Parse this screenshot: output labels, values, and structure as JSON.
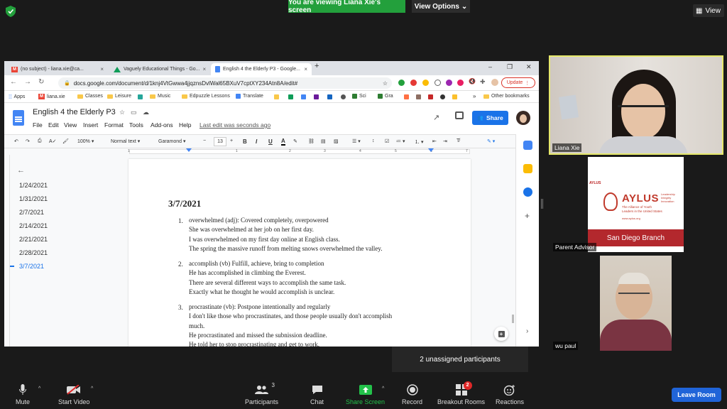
{
  "zoom": {
    "viewing_text": "You are viewing Liana Xie's screen",
    "view_options": "View Options",
    "view_label": "View",
    "unassigned": "2 unassigned participants",
    "participants_count": "3",
    "breakout_badge": "2",
    "controls": {
      "mute": "Mute",
      "start_video": "Start Video",
      "participants": "Participants",
      "chat": "Chat",
      "share_screen": "Share Screen",
      "record": "Record",
      "breakout_rooms": "Breakout Rooms",
      "reactions": "Reactions",
      "leave": "Leave Room"
    },
    "tiles": [
      {
        "name": "Liana Xie"
      },
      {
        "name": "Parent Advisor"
      },
      {
        "name": "wu paul"
      }
    ],
    "aylus": {
      "tag": "AYLUS",
      "word": "AYLUS",
      "subtitle": "The Alliance of Youth Leaders in the United States",
      "side": "Leadership Integrity Innovation",
      "url": "www.aylus.org",
      "branch": "San Diego Branch"
    },
    "colors": {
      "green": "#23a03c",
      "leave": "#2064d8",
      "highlight": "#e6e86b"
    }
  },
  "browser": {
    "tabs": [
      {
        "label": "(no subject) - liana.xie@ca..."
      },
      {
        "label": "Vaguely Educational Things - Go..."
      },
      {
        "label": "English 4 the Elderly P3 - Google..."
      }
    ],
    "url": "docs.google.com/document/d/1knj4VtGwwa4jjqznsDvlWal65BXuV7cptXY234Atn8A/edit#",
    "update_label": "Update",
    "bookmarks": [
      "Apps",
      "liana.xie",
      "Classes",
      "Leisure",
      "Music",
      "Edpuzzle Lessons",
      "Translate",
      "Sci",
      "Gra",
      "Other bookmarks"
    ]
  },
  "docs": {
    "title": "English 4 the Elderly P3",
    "menus": [
      "File",
      "Edit",
      "View",
      "Insert",
      "Format",
      "Tools",
      "Add-ons",
      "Help"
    ],
    "last_edit": "Last edit was seconds ago",
    "share": "Share",
    "toolbar": {
      "zoom": "100%",
      "style": "Normal text",
      "font": "Garamond",
      "size": "13",
      "bold": "B",
      "italic": "I",
      "underline": "U",
      "color": "A"
    },
    "outline": [
      "1/24/2021",
      "1/31/2021",
      "2/7/2021",
      "2/14/2021",
      "2/21/2021",
      "2/28/2021",
      "3/7/2021"
    ],
    "ruler_ticks": [
      "1",
      "1",
      "2",
      "3",
      "4",
      "5",
      "6",
      "7"
    ],
    "doc_date": "3/7/2021",
    "items": [
      {
        "num": "1.",
        "lines": [
          "overwhelmed (adj): Covered completely, overpowered",
          "She was overwhelmed at her job on her first day.",
          "I was overwhelmed on my first day online at English class.",
          "The spring the massive runoff from melting snows overwhelmed the valley."
        ]
      },
      {
        "num": "2.",
        "lines": [
          "accomplish (vb) Fulfill, achieve, bring to completion",
          "He has accomplished in climbing the Everest.",
          "There are several different ways to accomplish the same task.",
          "Exactly what he thought he would accomplish is unclear."
        ]
      },
      {
        "num": "3.",
        "lines": [
          "procrastinate (vb): Postpone intentionally and regularly",
          "I don't like those who procrastinates, and those people usually don't accomplish",
          "much.",
          "He procrastinated and missed the subnission deadline.",
          "He told her to stop procrastinating and get to work."
        ]
      }
    ]
  }
}
